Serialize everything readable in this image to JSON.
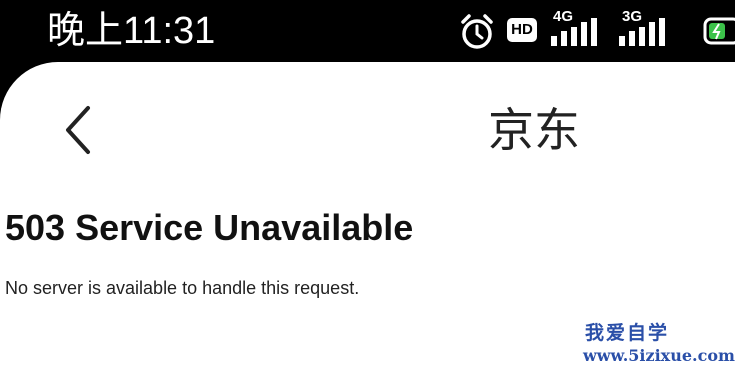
{
  "status_bar": {
    "time": "晚上11:31",
    "hd_label": "HD",
    "network_1": "4G",
    "network_2": "3G",
    "icons": [
      "alarm-icon",
      "hd-icon",
      "signal-icon",
      "signal-icon",
      "battery-icon"
    ],
    "battery_color": "#3cc24a"
  },
  "nav": {
    "back_icon": "chevron-left-icon",
    "title": "京东"
  },
  "page": {
    "heading": "503 Service Unavailable",
    "message": "No server is available to handle this request."
  },
  "watermark": {
    "line1": "我爱自学",
    "line2": "www.5izixue.com",
    "color": "#2a4fa8"
  }
}
